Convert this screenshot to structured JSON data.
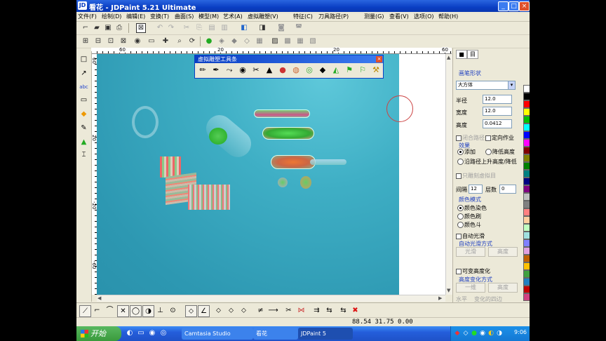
{
  "window": {
    "app_badge": "JD",
    "title": "看花 - JDPaint 5.21 Ultimate",
    "controls": [
      "_",
      "□",
      "×"
    ]
  },
  "menu": [
    "文件(F)",
    "绘制(D)",
    "编辑(E)",
    "变换(T)",
    "曲面(S)",
    "模型(M)",
    "艺术(A)",
    "虚拟雕塑(V)",
    "特征(C)",
    "刀具路径(P)",
    "测量(G)",
    "查看(V)",
    "选项(O)",
    "帮助(H)"
  ],
  "toolbar1_icons": [
    "new-icon",
    "open-icon",
    "save-icon",
    "print-icon",
    "select-box-icon",
    "undo-icon",
    "redo-icon",
    "cut-icon",
    "copy-icon",
    "paste-icon",
    "delete-icon",
    "layer-icon",
    "color-icon",
    "display-icon",
    "help-icon"
  ],
  "toolbar2_icons": [
    "zoom-window-icon",
    "zoom-all-icon",
    "zoom-in-icon",
    "zoom-out-icon",
    "pan-icon",
    "view-rotate-icon",
    "redraw-icon",
    "light-icon",
    "render-icon",
    "shade-icon",
    "wireframe-icon",
    "grid-icon",
    "snap-icon",
    "measure-icon"
  ],
  "left_tools": [
    "rect-tool",
    "polyline-tool",
    "abc-tool",
    "frame-tool",
    "fill-tool",
    "pen-tool",
    "bucket-tool",
    "ruler-tool"
  ],
  "left_tool_glyphs": [
    "□",
    "↗",
    "abc",
    "▭",
    "◆",
    "✎",
    "▲",
    "⌶"
  ],
  "ruler": {
    "h_labels": [
      "60",
      "20",
      "20",
      "60"
    ],
    "v_labels": [
      "60",
      "20",
      "-20",
      "-60"
    ]
  },
  "float_palette": {
    "title": "虚拟雕塑工具条",
    "close": "×",
    "icons": [
      "brush-icon",
      "smooth-icon",
      "push-icon",
      "stamp-icon",
      "cut-icon",
      "shape-icon",
      "sphere-icon",
      "ball-icon",
      "color-ball-icon",
      "pen-icon",
      "tilt-icon",
      "flag-icon",
      "flag2-icon",
      "hammer-icon"
    ],
    "glyphs": [
      "✏",
      "✒",
      "⤳",
      "◉",
      "✂",
      "▲",
      "●",
      "◍",
      "◎",
      "◆",
      "◭",
      "⚑",
      "⚐",
      "⚒"
    ]
  },
  "bottom_tools": [
    "line-tool",
    "polyline-tool",
    "arc-tool",
    "cross-tool",
    "circle-tool",
    "ellipse-tool",
    "tangent-tool",
    "point-tool",
    "angle-tool",
    "node-tool",
    "node2-tool",
    "node3-tool",
    "trim-tool",
    "extend-tool",
    "split-tool",
    "join-tool",
    "offset-tool",
    "mirror-tool",
    "delete-tool"
  ],
  "bottom_glyphs": [
    "⟋",
    "⌐",
    "⌒",
    "✕",
    "◯",
    "◑",
    "⊥",
    "⊙",
    "∠",
    "⬦",
    "⬦",
    "⬦",
    "≠",
    "⟶",
    "✂",
    "⋈",
    "⇉",
    "⇆",
    "✖"
  ],
  "status": {
    "coords": "88.54 31.75 0.00"
  },
  "panel": {
    "tabs": [
      "■",
      "目"
    ],
    "section_brush": "画笔形状",
    "shape_value": "大方体",
    "labels": {
      "radius": "半径",
      "width": "宽度",
      "height": "高度"
    },
    "values": {
      "radius": "12.0",
      "width": "12.0",
      "height": "0.0412"
    },
    "opt_closed": "闭合路径",
    "opt_fixed": "定向作业",
    "effect_title": "效果",
    "effect_opts": [
      "添加",
      "降低高度",
      "沿路径上升高度/降低"
    ],
    "checkbox_sym": "只雕刻虚拟目",
    "interval_label": "间隔",
    "interval_value": "12",
    "count_label": "层数",
    "count_value": "0",
    "mode_title": "颜色模式",
    "mode_opts": [
      "颜色染色",
      "颜色刷",
      "颜色斗"
    ],
    "auto_smooth": "自动光滑",
    "auto_smooth_way": "自动光滑方式",
    "smooth_btns": [
      "光滑",
      "高度"
    ],
    "variable_height": "可变高度化",
    "variable_height_way": "高度变化方式",
    "height_btns": [
      "一维",
      "高度"
    ],
    "bottom_btns": [
      "水平",
      "变化的四边"
    ]
  },
  "palette_colors": [
    "#ffffff",
    "#000000",
    "#ff0000",
    "#ffff00",
    "#00c000",
    "#00ffff",
    "#0000ff",
    "#ff00ff",
    "#800000",
    "#808000",
    "#008000",
    "#008080",
    "#000080",
    "#800080",
    "#c0c0c0",
    "#808080",
    "#ff8080",
    "#ffd0a0",
    "#c0ffc0",
    "#a0e0e0",
    "#8080ff",
    "#e0a0e0",
    "#c06000",
    "#ffc000",
    "#40a040",
    "#2080c0",
    "#c00000",
    "#d04080"
  ],
  "taskbar": {
    "start": "开始",
    "tasks": [
      "Camtasia Studio",
      "看花",
      "JDPaint 5"
    ],
    "clock": "9:06"
  }
}
